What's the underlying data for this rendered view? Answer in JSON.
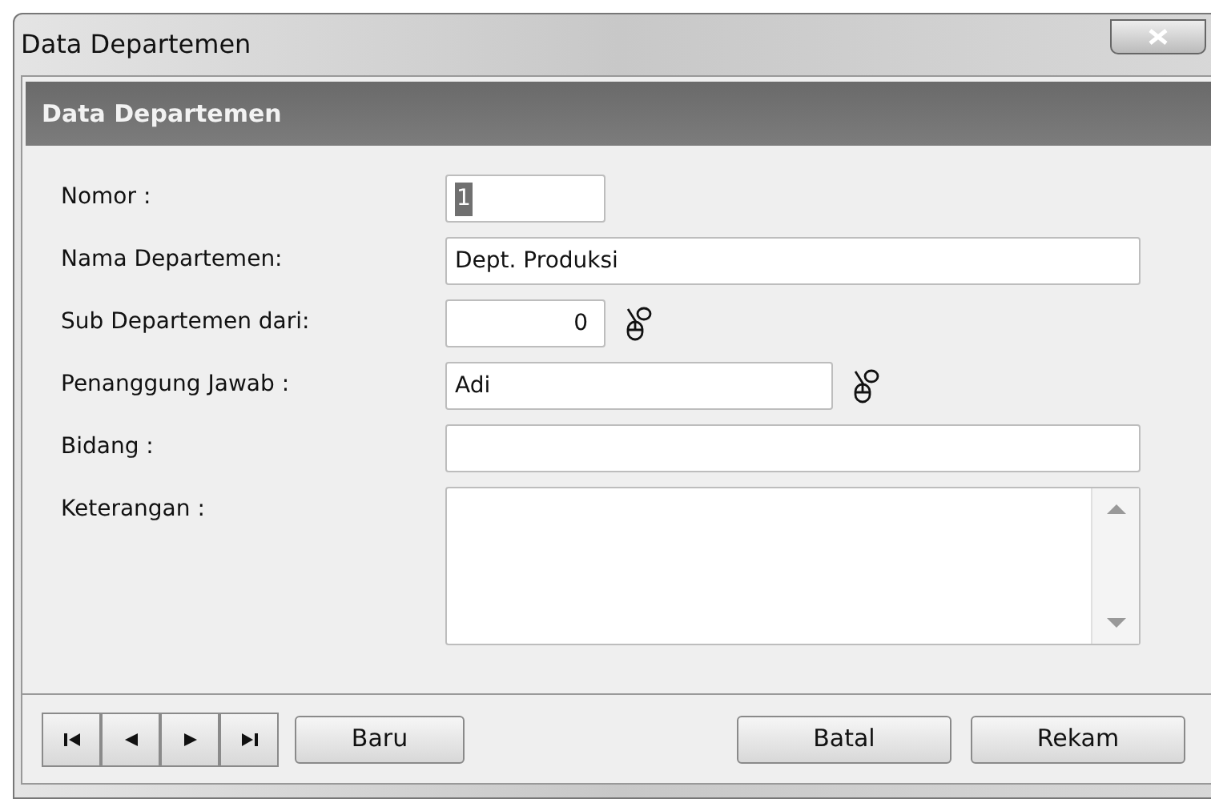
{
  "window": {
    "title": "Data Departemen"
  },
  "header": {
    "title": "Data Departemen"
  },
  "fields": [
    {
      "label": "Nomor :",
      "value": "1",
      "kind": "short",
      "text_selected": true
    },
    {
      "label": "Nama Departemen:",
      "value": "Dept. Produksi",
      "kind": "long",
      "text_selected": false
    },
    {
      "label": "Sub Departemen dari:",
      "value": "0",
      "kind": "number-lookup",
      "text_selected": false
    },
    {
      "label": "Penanggung Jawab :",
      "value": "Adi",
      "kind": "medium-lookup",
      "text_selected": false
    },
    {
      "label": "Bidang :",
      "kind": "long",
      "text_selected": false
    },
    {
      "label": "Keterangan :",
      "kind": "textarea",
      "text_selected": false
    }
  ],
  "navigation": [
    {
      "kind": "first"
    },
    {
      "kind": "previous"
    },
    {
      "kind": "next"
    },
    {
      "kind": "last"
    }
  ],
  "left_buttons": [
    "Baru"
  ],
  "right_buttons": [
    "Batal",
    "Rekam"
  ]
}
